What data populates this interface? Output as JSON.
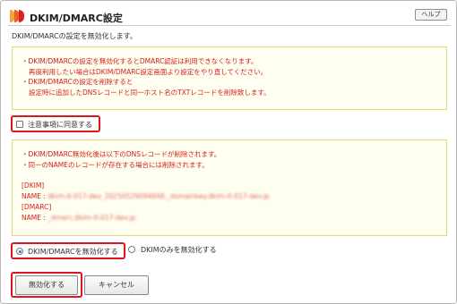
{
  "header": {
    "title": "DKIM/DMARC設定",
    "help_label": "ヘルプ"
  },
  "intro_text": "DKIM/DMARCの設定を無効化します。",
  "notice": {
    "lines": [
      "・DKIM/DMARCの設定を無効化するとDMARC認証は利用できなくなります。",
      "再度利用したい場合はDKIM/DMARC設定画面より設定をやり直してください。",
      "・DKIM/DMARCの設定を削除すると",
      "設定時に追加したDNSレコードと同一ホスト名のTXTレコードを削除致します。"
    ]
  },
  "agree": {
    "label": "注意事項に同意する",
    "checked": false
  },
  "dns_notice": {
    "lines": [
      "・DKIM/DMARC無効化後は以下のDNSレコードが削除されます。",
      "・同一のNAMEのレコードが存在する場合には削除されます。"
    ],
    "dkim_heading": "[DKIM]",
    "dkim_name_label": "NAME : ",
    "dkim_name_value": "dkim-it-017-dev_20250529094848._domainkey.dkim-it-017-dev.jp",
    "dmarc_heading": "[DMARC]",
    "dmarc_name_label": "NAME : ",
    "dmarc_name_value": "_dmarc.dkim-it-017-dev.jp"
  },
  "options": {
    "disable_both_label": "DKIM/DMARCを無効化する",
    "disable_dkim_only_label": "DKIMのみを無効化する",
    "selected": "disable_both"
  },
  "buttons": {
    "disable_label": "無効化する",
    "cancel_label": "キャンセル"
  },
  "colors": {
    "warning_text": "#d8201c",
    "highlight_border": "#e0151d",
    "notice_background": "#fefff0"
  }
}
